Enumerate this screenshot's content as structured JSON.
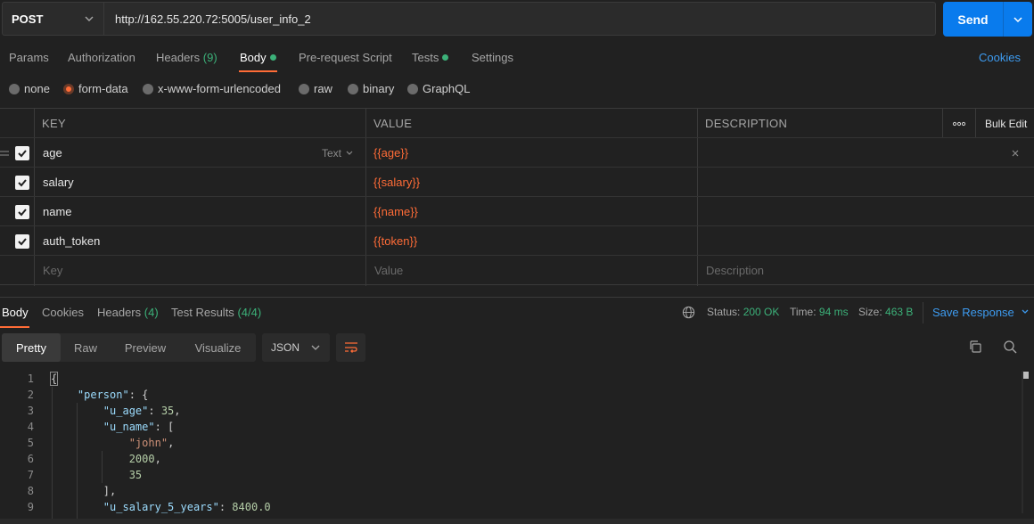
{
  "request": {
    "method": "POST",
    "url": "http://162.55.220.72:5005/user_info_2",
    "send_label": "Send"
  },
  "req_tabs": [
    {
      "label": "Params"
    },
    {
      "label": "Authorization"
    },
    {
      "label": "Headers",
      "count": "(9)"
    },
    {
      "label": "Body"
    },
    {
      "label": "Pre-request Script"
    },
    {
      "label": "Tests"
    },
    {
      "label": "Settings"
    }
  ],
  "cookies_label": "Cookies",
  "body_modes": [
    "none",
    "form-data",
    "x-www-form-urlencoded",
    "raw",
    "binary",
    "GraphQL"
  ],
  "selected_body_mode": "form-data",
  "table": {
    "headers": {
      "key": "KEY",
      "value": "VALUE",
      "description": "DESCRIPTION",
      "bulk_edit": "Bulk Edit"
    },
    "type_label": "Text",
    "rows": [
      {
        "key": "age",
        "value": "{{age}}"
      },
      {
        "key": "salary",
        "value": "{{salary}}"
      },
      {
        "key": "name",
        "value": "{{name}}"
      },
      {
        "key": "auth_token",
        "value": "{{token}}"
      }
    ],
    "placeholders": {
      "key": "Key",
      "value": "Value",
      "description": "Description"
    }
  },
  "response": {
    "tabs": [
      {
        "label": "Body"
      },
      {
        "label": "Cookies"
      },
      {
        "label": "Headers",
        "count": "(4)"
      },
      {
        "label": "Test Results",
        "count": "(4/4)"
      }
    ],
    "status_label": "Status:",
    "status_value": "200 OK",
    "time_label": "Time:",
    "time_value": "94 ms",
    "size_label": "Size:",
    "size_value": "463 B",
    "save_label": "Save Response",
    "view_modes": [
      "Pretty",
      "Raw",
      "Preview",
      "Visualize"
    ],
    "format": "JSON",
    "code_lines": [
      "{",
      "    \"person\": {",
      "        \"u_age\": 35,",
      "        \"u_name\": [",
      "            \"john\",",
      "            2000,",
      "            35",
      "        ],",
      "        \"u_salary_5_years\": 8400.0"
    ]
  },
  "colors": {
    "accent": "#ff6c37",
    "send": "#097bed",
    "link": "#3d9bf0",
    "success": "#3cb179"
  }
}
